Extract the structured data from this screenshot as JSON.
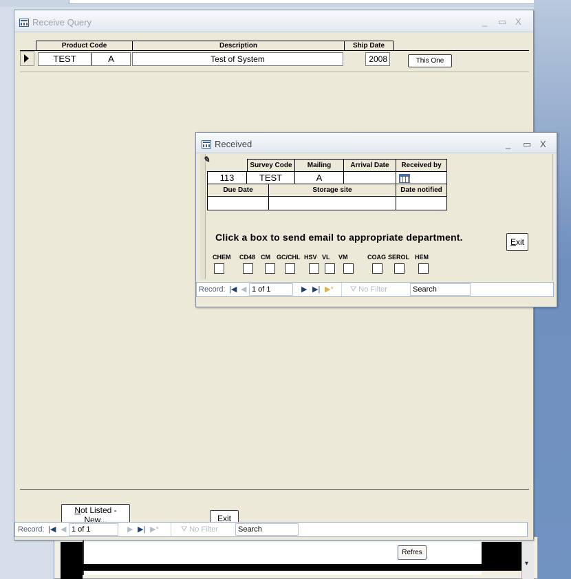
{
  "receive_query": {
    "title": "Receive Query",
    "window_controls": {
      "minimize": "_",
      "maximize": "▭",
      "close": "X"
    },
    "columns": {
      "product_code": "Product Code",
      "description": "Description",
      "ship_date": "Ship Date"
    },
    "row": {
      "product_code": "TEST",
      "variant": "A",
      "description": "Test of System",
      "ship_date": "2008"
    },
    "this_one_label": "This One",
    "not_listed_label": "Not Listed - New...",
    "not_listed_accel": "N",
    "not_listed_rest": "ot Listed - New...",
    "exit_accel": "E",
    "exit_rest": "xit",
    "nav": {
      "record_label": "Record:",
      "position": "1 of 1",
      "no_filter": "No Filter",
      "search": "Search"
    }
  },
  "received": {
    "title": "Received",
    "window_controls": {
      "minimize": "_",
      "maximize": "▭",
      "close": "X"
    },
    "headers": {
      "survey_code": "Survey Code",
      "mailing": "Mailing",
      "arrival_date": "Arrival Date",
      "received_by": "Received by",
      "due_date": "Due Date",
      "storage_site": "Storage site",
      "date_notified": "Date notified"
    },
    "values": {
      "id": "113",
      "survey_code": "TEST",
      "mailing": "A",
      "arrival_date": "",
      "due_date": "",
      "storage_site": "",
      "date_notified": ""
    },
    "message": "Click a box to send email to appropriate department.",
    "exit_accel": "E",
    "exit_rest": "xit",
    "departments": [
      "CHEM",
      "CD48",
      "CM",
      "GC/CHL",
      "HSV",
      "VL",
      "VM",
      "COAG",
      "SEROL",
      "HEM"
    ],
    "nav": {
      "record_label": "Record:",
      "position": "1 of 1",
      "no_filter": "No Filter",
      "search": "Search"
    }
  },
  "background_window": {
    "refresh_label": "Refres"
  }
}
